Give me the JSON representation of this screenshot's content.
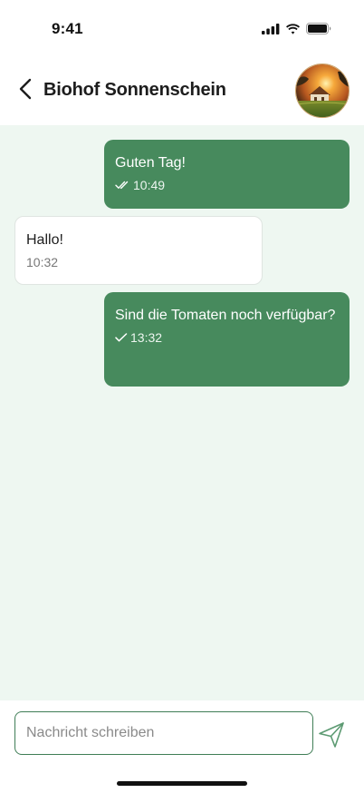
{
  "status_bar": {
    "time": "9:41"
  },
  "header": {
    "contact_name": "Biohof Sonnenschein",
    "back_icon": "chevron-left-icon",
    "avatar_icon": "farm-avatar"
  },
  "messages": [
    {
      "direction": "outgoing",
      "text": "Guten Tag!",
      "time": "10:49",
      "status": "read"
    },
    {
      "direction": "incoming",
      "text": "Hallo!",
      "time": "10:32"
    },
    {
      "direction": "outgoing",
      "text": "Sind die Tomaten noch verfügbar?",
      "time": "13:32",
      "status": "sent"
    }
  ],
  "composer": {
    "placeholder": "Nachricht schreiben",
    "value": "",
    "send_icon": "send-icon"
  },
  "colors": {
    "brand_green": "#478a5d",
    "chat_background": "#eef7f1",
    "input_border": "#3f7d56"
  }
}
